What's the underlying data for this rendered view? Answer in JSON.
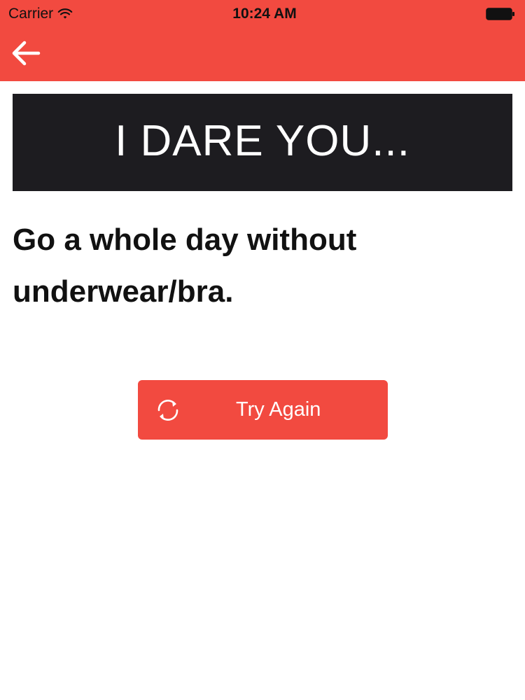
{
  "status_bar": {
    "carrier": "Carrier",
    "time": "10:24 AM",
    "wifi_icon": "wifi-icon",
    "battery_icon": "battery-icon"
  },
  "nav_bar": {
    "back_icon": "arrow-left-icon",
    "background_color": "#f24a40"
  },
  "banner": {
    "text": "I DARE YOU...",
    "background_color": "#1d1c20"
  },
  "dare": {
    "text": "Go a whole day without underwear/bra."
  },
  "try_again_button": {
    "label": "Try Again",
    "icon": "refresh-icon",
    "background_color": "#f24a40"
  }
}
